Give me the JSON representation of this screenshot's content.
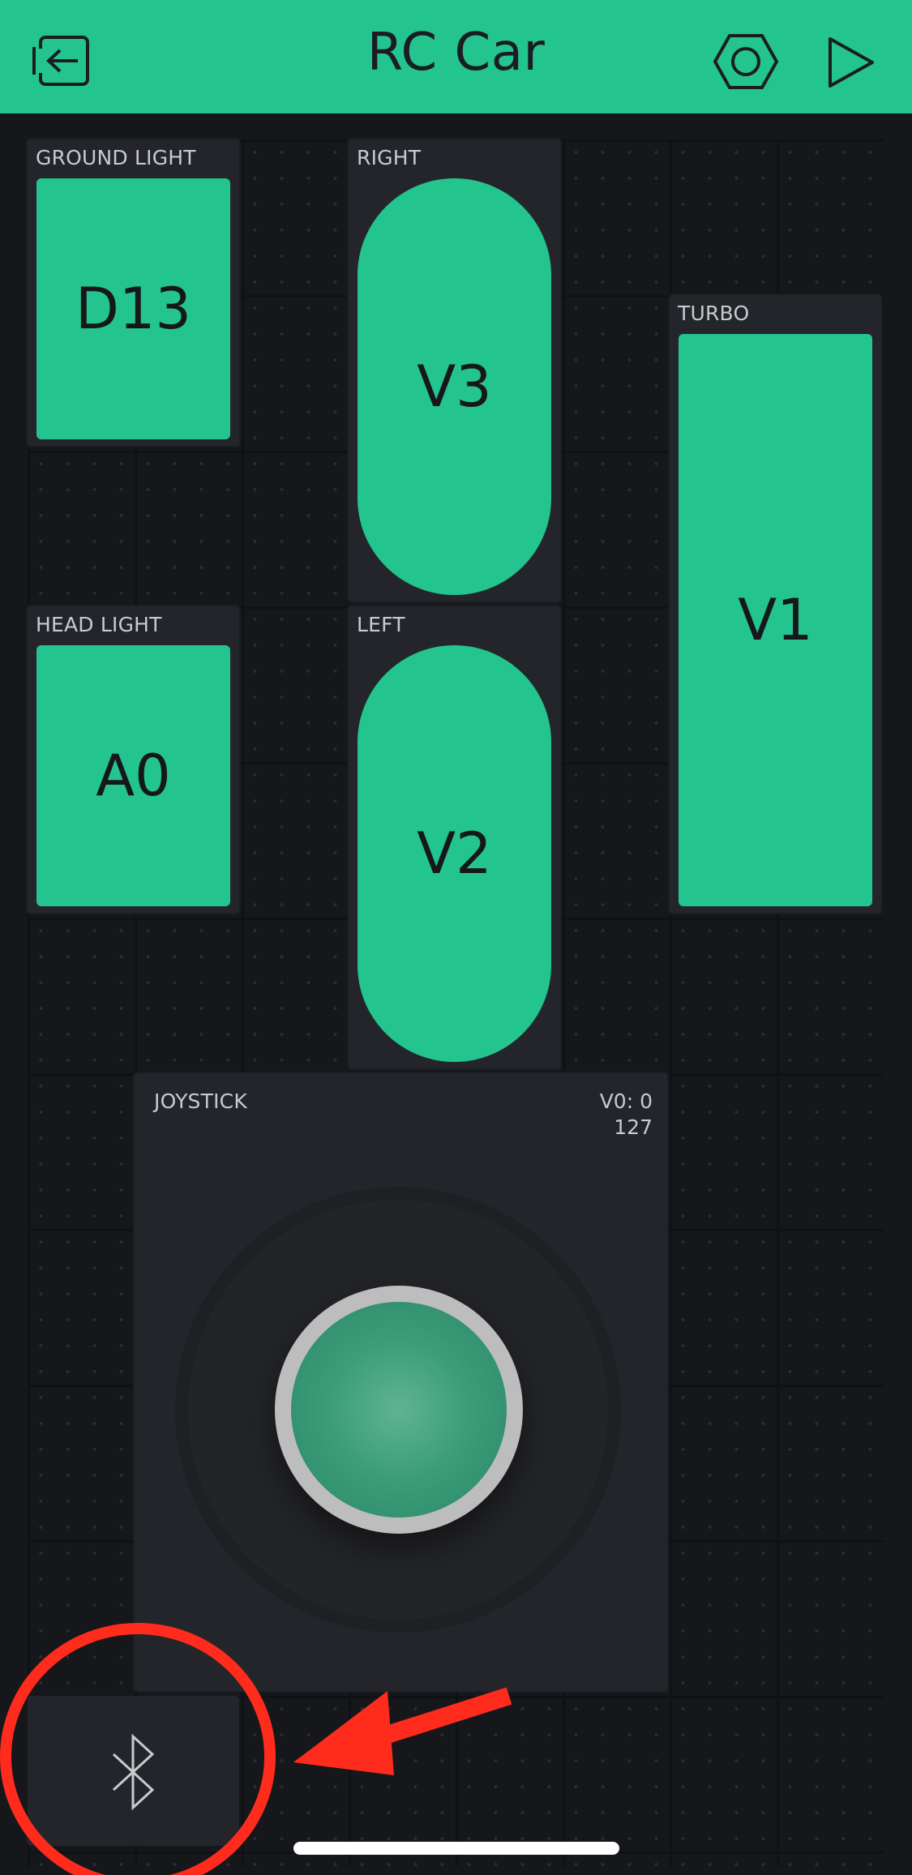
{
  "header": {
    "title": "RC Car",
    "icons": [
      "exit-icon",
      "settings-hexagon-icon",
      "play-icon"
    ],
    "color": "#23c48e"
  },
  "widgets": {
    "ground_light": {
      "label": "GROUND LIGHT",
      "pin": "D13"
    },
    "right": {
      "label": "RIGHT",
      "pin": "V3"
    },
    "turbo": {
      "label": "TURBO",
      "pin": "V1"
    },
    "head_light": {
      "label": "HEAD LIGHT",
      "pin": "A0"
    },
    "left": {
      "label": "LEFT",
      "pin": "V2"
    },
    "joystick": {
      "label": "JOYSTICK",
      "value_line1": "V0: 0",
      "value_line2": "127"
    },
    "bluetooth": {
      "icon": "bluetooth-icon"
    }
  },
  "annotation": {
    "color": "#ff2b1c",
    "shapes": [
      "circle",
      "arrow"
    ]
  }
}
